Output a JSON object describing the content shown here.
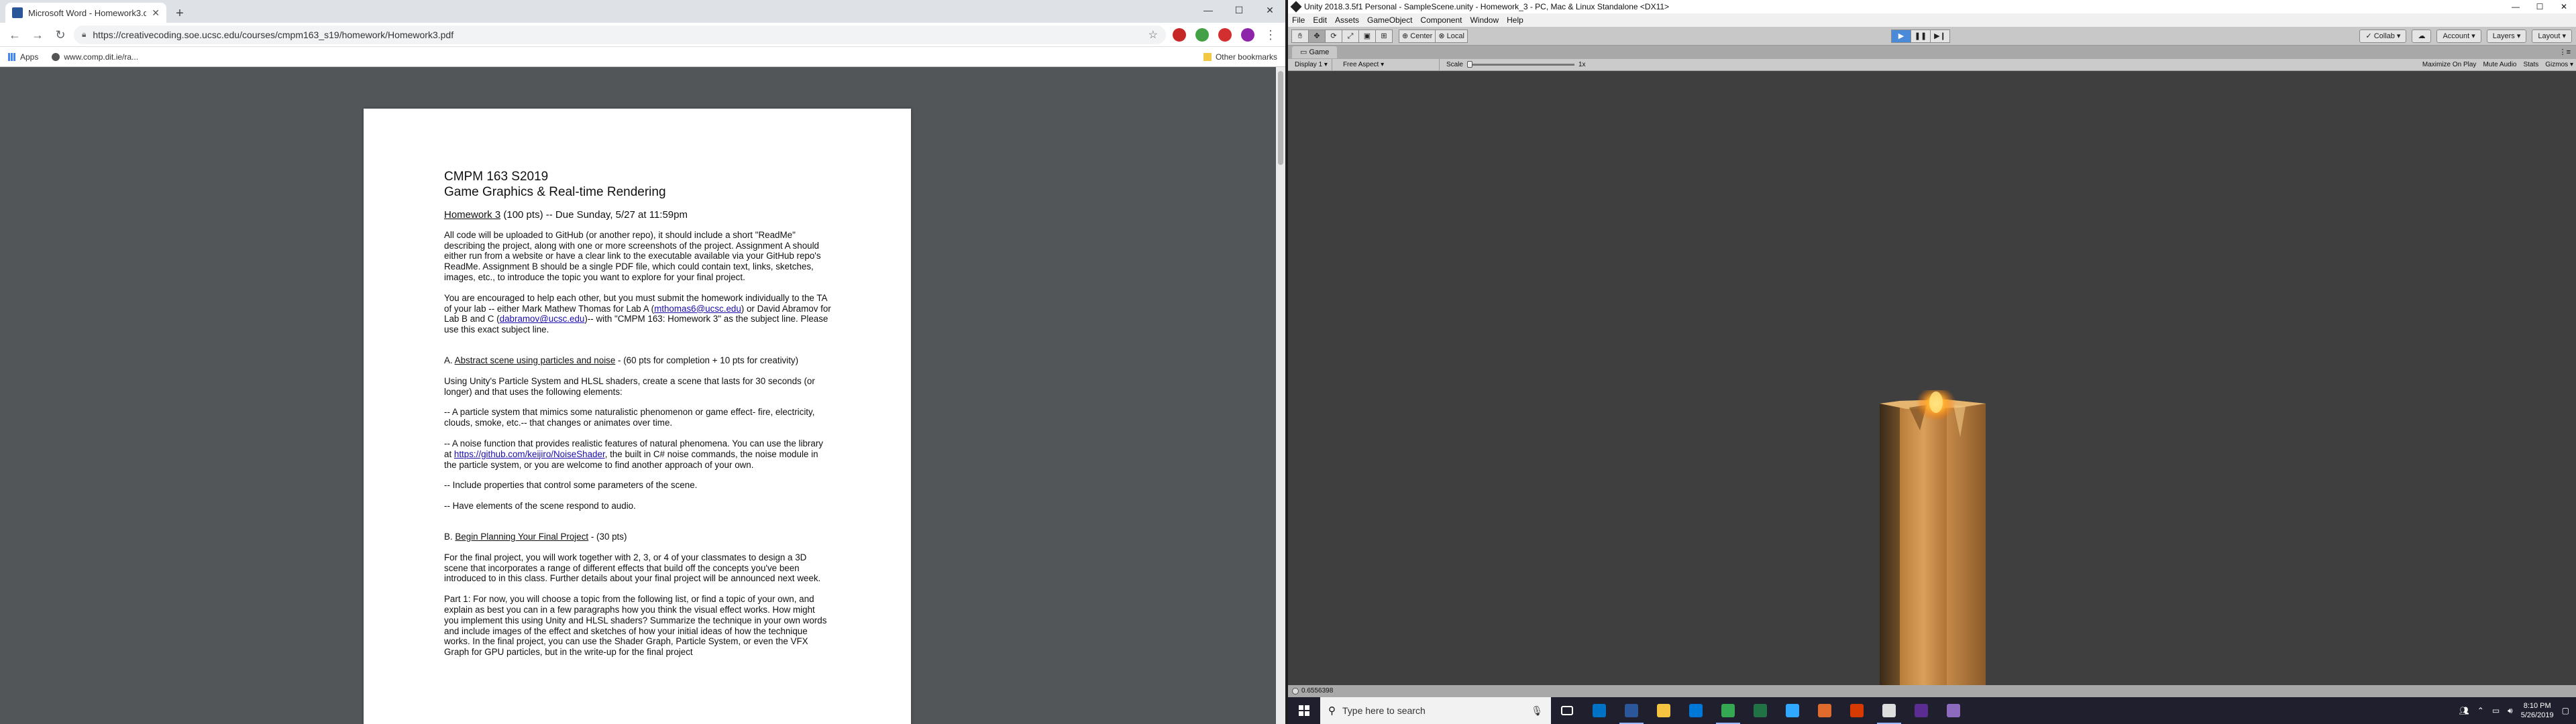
{
  "browser": {
    "tab_title": "Microsoft Word - Homework3.d",
    "url": "https://creativecoding.soe.ucsc.edu/courses/cmpm163_s19/homework/Homework3.pdf",
    "bookmarks": [
      {
        "label": "Apps"
      },
      {
        "label": "www.comp.dit.ie/ra..."
      }
    ],
    "other_bookmarks": "Other bookmarks"
  },
  "document": {
    "course": "CMPM 163 S2019",
    "subtitle": "Game Graphics & Real-time Rendering",
    "hw_title": "Homework 3",
    "hw_rest": " (100 pts) -- Due Sunday, 5/27 at 11:59pm",
    "p1": "All code will be uploaded to GitHub (or another repo), it should include a short \"ReadMe\" describing the project, along with one or more screenshots of the project. Assignment A should either run from a website or have a clear link to the executable available via your GitHub repo's ReadMe. Assignment B should be a single PDF file, which could contain text, links, sketches, images, etc., to introduce the topic you want to explore for your final project.",
    "p2_a": "You are encouraged to help each other, but you must submit the homework individually to the TA of your lab -- either Mark Mathew Thomas for Lab A (",
    "p2_link1": "mthomas6@ucsc.edu",
    "p2_b": ") or David Abramov for Lab B and C (",
    "p2_link2": "dabramov@ucsc.edu",
    "p2_c": ")-- with \"CMPM 163: Homework 3\" as the subject line. Please use this exact subject line.",
    "secA_prefix": "A. ",
    "secA_title": "Abstract scene using particles and noise",
    "secA_rest": " - (60 pts for completion + 10 pts for creativity)",
    "secA_intro": "Using Unity's Particle System and HLSL shaders, create a scene that lasts for 30 seconds (or longer) and that uses the following elements:",
    "bullet1": "-- A particle system that mimics some naturalistic phenomenon or game effect- fire, electricity, clouds, smoke, etc.-- that changes or animates over time.",
    "bullet2_a": "-- A noise function that provides realistic features of natural phenomena. You can use the library at ",
    "bullet2_link": "https://github.com/keijiro/NoiseShader",
    "bullet2_b": ", the built in C# noise commands, the noise module in the particle system, or you are welcome to find another approach of your own.",
    "bullet3": "-- Include properties that control some parameters of the scene.",
    "bullet4": "-- Have elements of the scene respond to audio.",
    "secB_prefix": "B. ",
    "secB_title": "Begin Planning Your Final Project",
    "secB_rest": " - (30 pts)",
    "secB_p1": "For the final project, you will work together with 2, 3, or 4 of your classmates to design a 3D scene that incorporates a range of different effects that build off the concepts you've been introduced to in this class. Further details about your final project will be announced next week.",
    "secB_p2": "Part 1: For now, you will choose a topic from the following list, or find a topic of your own, and explain as best you can in a few paragraphs how you think the visual effect works. How might you implement this using Unity and HLSL shaders? Summarize the technique in your own words and include images of the effect and sketches of how your initial ideas of how the technique works. In the final project, you can use the Shader Graph, Particle System, or even the VFX Graph for GPU particles, but in the write-up for the final project"
  },
  "unity": {
    "title": "Unity 2018.3.5f1 Personal - SampleScene.unity - Homework_3 - PC, Mac & Linux Standalone <DX11>",
    "menu": [
      "File",
      "Edit",
      "Assets",
      "GameObject",
      "Component",
      "Window",
      "Help"
    ],
    "pivot": "Center",
    "space": "Local",
    "collab": "Collab",
    "account": "Account",
    "layers": "Layers",
    "layout": "Layout",
    "game_tab": "Game",
    "display": "Display 1",
    "aspect": "Free Aspect",
    "scale_label": "Scale",
    "scale_value": "1x",
    "maximize": "Maximize On Play",
    "mute": "Mute Audio",
    "stats": "Stats",
    "gizmos": "Gizmos",
    "status": "0.6556398",
    "accent": "#4a8ad8"
  },
  "taskbar": {
    "search_placeholder": "Type here to search",
    "time": "8:10 PM",
    "date": "5/26/2019",
    "apps": [
      {
        "icon": "task-view-icon",
        "color": "#ffffff"
      },
      {
        "icon": "outlook-icon",
        "color": "#0072c6"
      },
      {
        "icon": "word-icon",
        "color": "#2b579a"
      },
      {
        "icon": "file-explorer-icon",
        "color": "#f5c542"
      },
      {
        "icon": "store-icon",
        "color": "#0078d7"
      },
      {
        "icon": "chrome-icon",
        "color": "#34a853"
      },
      {
        "icon": "excel-icon",
        "color": "#217346"
      },
      {
        "icon": "photoshop-icon",
        "color": "#31a8ff"
      },
      {
        "icon": "app-orange-icon",
        "color": "#e06b2c"
      },
      {
        "icon": "app-red-icon",
        "color": "#d83b01"
      },
      {
        "icon": "unity-icon",
        "color": "#dddddd"
      },
      {
        "icon": "visual-studio-icon",
        "color": "#5c2d91"
      },
      {
        "icon": "app-purple-icon",
        "color": "#8e6bbf"
      }
    ]
  }
}
